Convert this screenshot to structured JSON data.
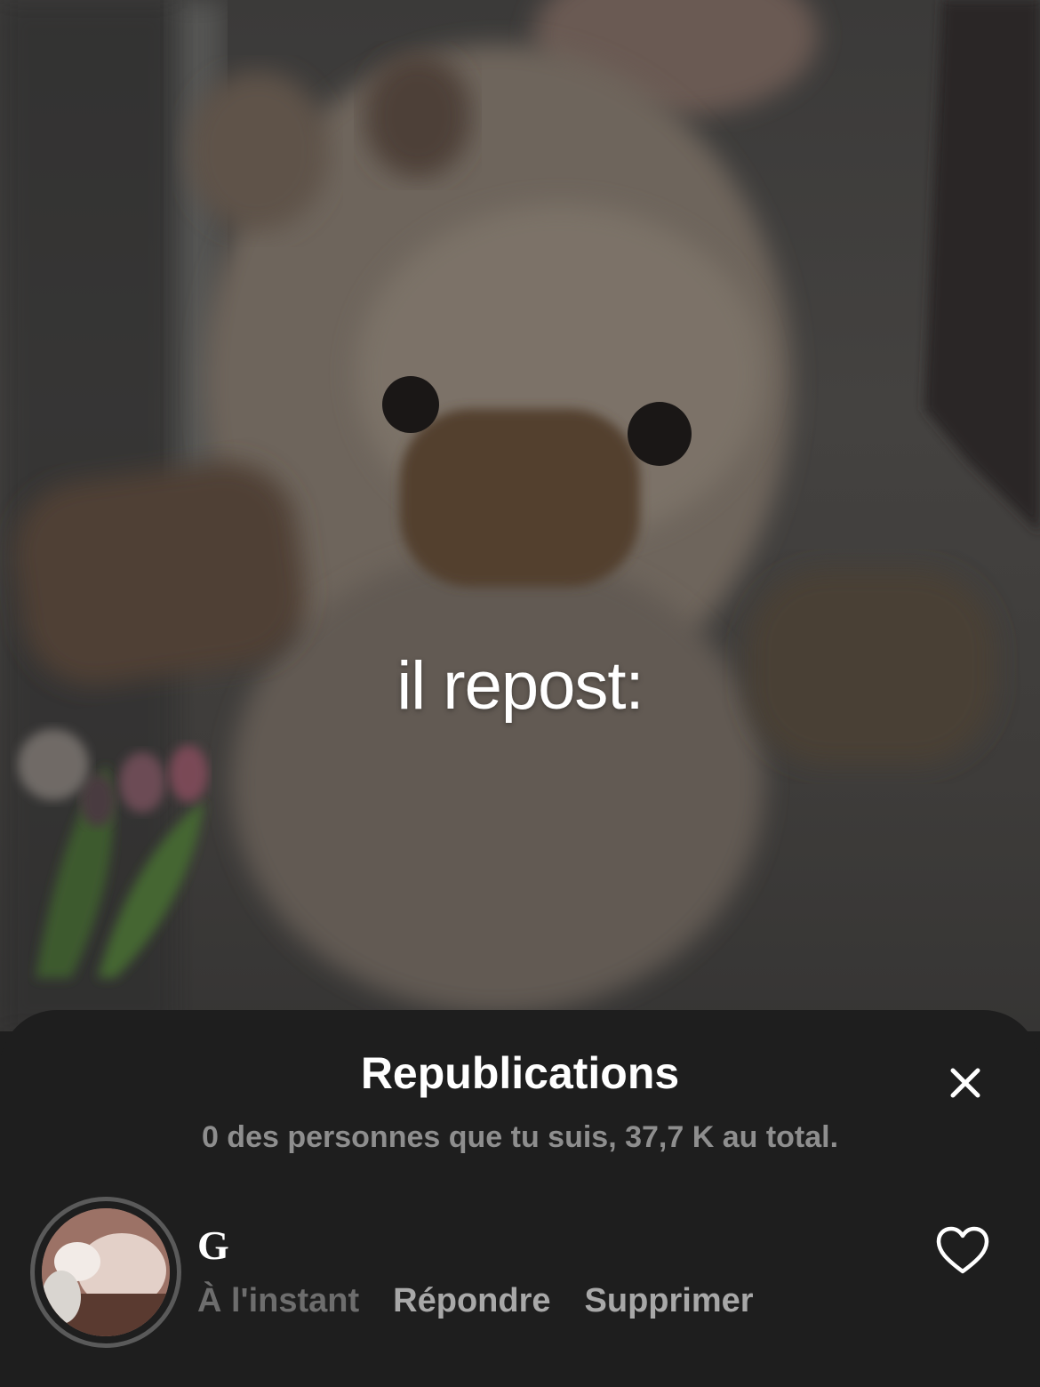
{
  "video": {
    "overlay_text": "il repost:"
  },
  "sheet": {
    "title": "Republications",
    "subtitle": "0 des personnes que tu suis, 37,7 K au total.",
    "close_icon": "close-icon"
  },
  "reposts": [
    {
      "username": "G",
      "time": "À l'instant",
      "reply_label": "Répondre",
      "delete_label": "Supprimer",
      "like_icon": "heart-outline-icon"
    }
  ],
  "colors": {
    "sheet_background": "#1e1e1e",
    "title": "#ffffff",
    "subtitle": "#8e8e8e",
    "muted_action": "#6d6d6d",
    "action": "#a8a8a8"
  }
}
